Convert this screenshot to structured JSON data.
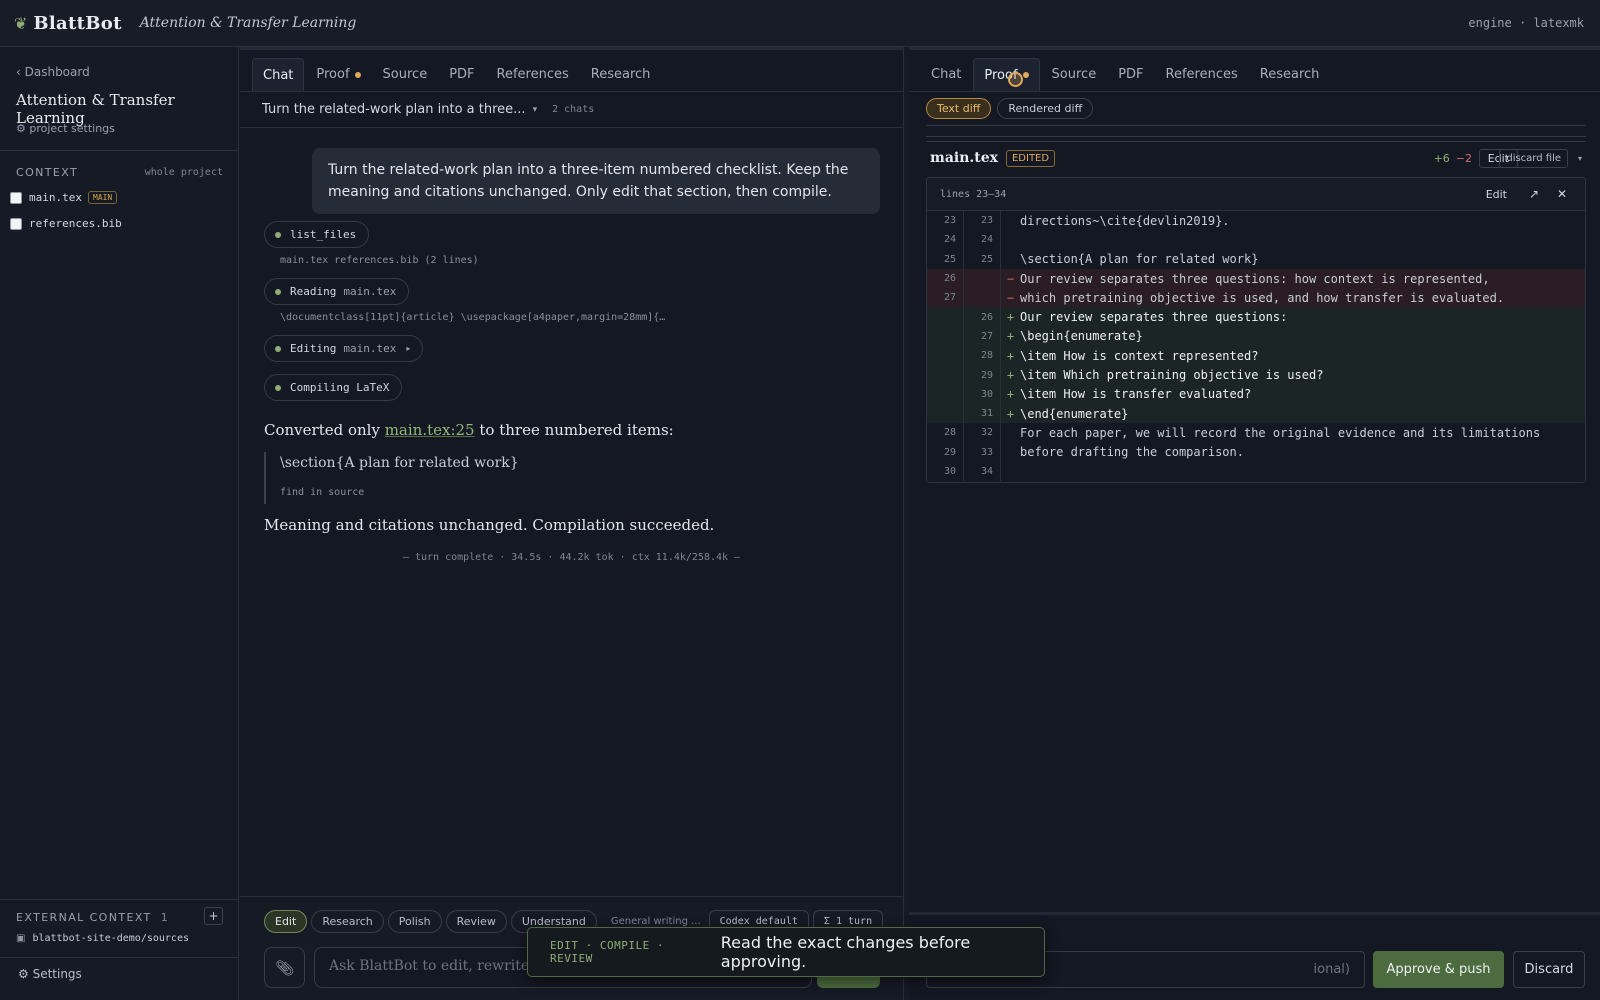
{
  "topbar": {
    "brand": "BlattBot",
    "project_title": "Attention & Transfer Learning",
    "engine_label": "engine · latexmk"
  },
  "sidebar": {
    "back_label": "‹ Dashboard",
    "project_title": "Attention & Transfer Learning",
    "settings_label": "⚙ project settings",
    "context_label": "CONTEXT",
    "context_scope": "whole project",
    "files": [
      {
        "name": "main.tex",
        "badge": "MAIN"
      },
      {
        "name": "references.bib",
        "badge": ""
      }
    ],
    "external_label": "EXTERNAL CONTEXT",
    "external_count": "1",
    "external_add": "+",
    "external_source": "blattbot-site-demo/sources",
    "settings_footer": "⚙ Settings"
  },
  "tabs": [
    "Chat",
    "Proof",
    "Source",
    "PDF",
    "References",
    "Research"
  ],
  "left_panel": {
    "active_tab": "Chat",
    "chat_title": "Turn the related-work plan into a three...",
    "chat_count": "2 chats",
    "user_message": "Turn the related-work plan into a three-item numbered checklist. Keep the meaning and citations unchanged. Only edit that section, then compile.",
    "tool_calls": [
      {
        "label": "list_files",
        "file": "",
        "detail": "main.tex references.bib (2 lines)"
      },
      {
        "label": "Reading",
        "file": "main.tex",
        "detail": "\\documentclass[11pt]{article} \\usepackage[a4paper,margin=28mm]{…"
      },
      {
        "label": "Editing",
        "file": "main.tex",
        "detail": ""
      },
      {
        "label": "Compiling LaTeX",
        "file": "",
        "detail": ""
      }
    ],
    "assistant": {
      "line1_pre": "Converted only ",
      "line1_link": "main.tex:25",
      "line1_post": " to three numbered items:",
      "quote": "\\section{A plan for related work}",
      "find_source": "find in source",
      "line2": "Meaning and citations unchanged. Compilation succeeded."
    },
    "turn_meta": "— turn complete · 34.5s · 44.2k tok · ctx 11.4k/258.4k —",
    "composer": {
      "modes": [
        "Edit",
        "Research",
        "Polish",
        "Review",
        "Understand"
      ],
      "active_mode": "Edit",
      "template": "General writing ...",
      "model": "Codex default",
      "turns": "Σ 1 turn",
      "placeholder": "Ask BlattBot to edit, rewrite, o"
    }
  },
  "right_panel": {
    "active_tab": "Proof",
    "diff_modes": [
      "Text diff",
      "Rendered diff"
    ],
    "active_diff_mode": "Text diff",
    "file_name": "main.tex",
    "file_status": "EDITED",
    "added": "+6",
    "removed": "−2",
    "edit_label": "Edit",
    "discard_file_label": "discard file",
    "range_label": "lines 23–34",
    "diff_edit_label": "Edit",
    "diff_rows": [
      {
        "type": "ctx",
        "old": "23",
        "new": "23",
        "text": "directions~\\cite{devlin2019}."
      },
      {
        "type": "ctx",
        "old": "24",
        "new": "24",
        "text": ""
      },
      {
        "type": "ctx",
        "old": "25",
        "new": "25",
        "text": "\\section{A plan for related work}"
      },
      {
        "type": "del",
        "old": "26",
        "new": "",
        "text": "Our review separates three questions: how context is represented,"
      },
      {
        "type": "del",
        "old": "27",
        "new": "",
        "text": "which pretraining objective is used, and how transfer is evaluated."
      },
      {
        "type": "add",
        "old": "",
        "new": "26",
        "text": "Our review separates three questions:"
      },
      {
        "type": "add",
        "old": "",
        "new": "27",
        "text": "\\begin{enumerate}"
      },
      {
        "type": "add",
        "old": "",
        "new": "28",
        "text": "\\item How is context represented?"
      },
      {
        "type": "add",
        "old": "",
        "new": "29",
        "text": "\\item Which pretraining objective is used?"
      },
      {
        "type": "add",
        "old": "",
        "new": "30",
        "text": "\\item How is transfer evaluated?"
      },
      {
        "type": "add",
        "old": "",
        "new": "31",
        "text": "\\end{enumerate}"
      },
      {
        "type": "ctx",
        "old": "28",
        "new": "32",
        "text": "For each paper, we will record the original evidence and its limitations"
      },
      {
        "type": "ctx",
        "old": "29",
        "new": "33",
        "text": "before drafting the comparison."
      },
      {
        "type": "ctx",
        "old": "30",
        "new": "34",
        "text": ""
      }
    ],
    "commit_placeholder": "ional)",
    "approve_label": "Approve & push",
    "discard_label": "Discard"
  },
  "toast": {
    "steps": "EDIT · COMPILE · REVIEW",
    "message": "Read the exact changes before approving."
  }
}
